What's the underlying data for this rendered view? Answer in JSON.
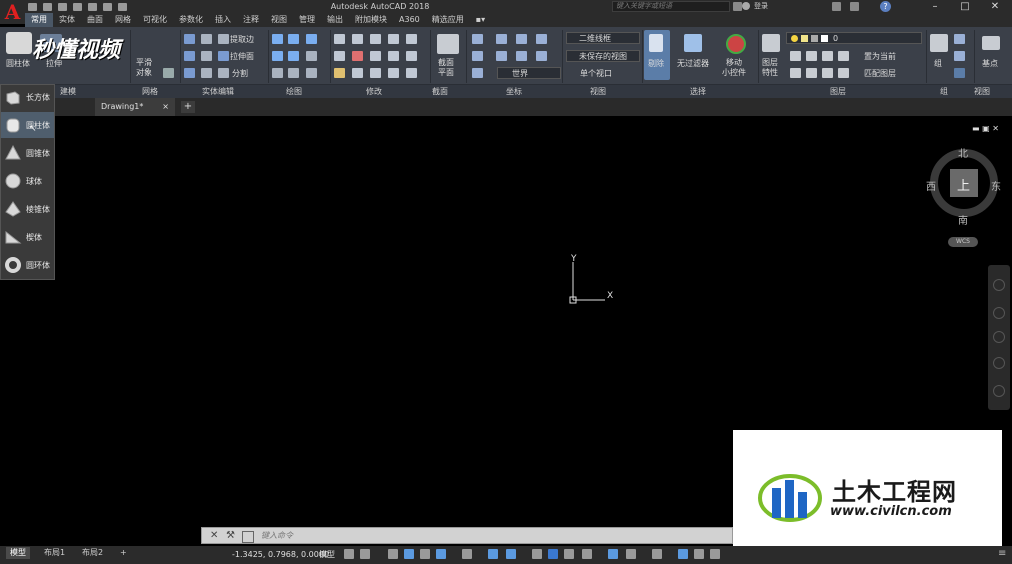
{
  "app": {
    "title": "Autodesk AutoCAD 2018"
  },
  "search": {
    "placeholder": "键入关键字或短语"
  },
  "user": {
    "login_label": "登录"
  },
  "ribbon_tabs": [
    "常用",
    "实体",
    "曲面",
    "网格",
    "可视化",
    "参数化",
    "插入",
    "注释",
    "视图",
    "管理",
    "输出",
    "附加模块",
    "A360",
    "精选应用"
  ],
  "ribbon": {
    "cylinder_btn": "圆柱体",
    "extrude_btn": "拉伸",
    "smooth_object": "平滑\n对象",
    "extract_edges": "提取边",
    "extrude_face": "拉伸面",
    "split": "分割",
    "section_plane": "截面\n平面",
    "visual_style": "二维线框",
    "saved_view": "未保存的视图",
    "ucs_world": "世界",
    "single_viewport": "单个视口",
    "culling": "剔除",
    "no_filter": "无过滤器",
    "move_gizmo": "移动\n小控件",
    "layer_props": "图层\n特性",
    "layer_name": "0",
    "set_current": "置为当前",
    "match_layer": "匹配图层",
    "group": "组",
    "base_point": "基点",
    "panel_labels": [
      "建模",
      "网格",
      "实体编辑",
      "绘图",
      "修改",
      "截面",
      "坐标",
      "视图",
      "选择",
      "图层",
      "组",
      "视图"
    ]
  },
  "doc_tab": {
    "name": "Drawing1*"
  },
  "solid_menu": {
    "items": [
      {
        "label": "长方体",
        "icon": "box-icon"
      },
      {
        "label": "圆柱体",
        "icon": "cylinder-icon",
        "selected": true
      },
      {
        "label": "圆锥体",
        "icon": "cone-icon"
      },
      {
        "label": "球体",
        "icon": "sphere-icon"
      },
      {
        "label": "棱锥体",
        "icon": "pyramid-icon"
      },
      {
        "label": "楔体",
        "icon": "wedge-icon"
      },
      {
        "label": "圆环体",
        "icon": "torus-icon"
      }
    ]
  },
  "viewcube": {
    "north": "北",
    "south": "南",
    "east": "东",
    "west": "西",
    "face": "上",
    "wcs": "WCS"
  },
  "ucs": {
    "x": "X",
    "y": "Y"
  },
  "watermark": {
    "brand": "秒懂视频",
    "site_cn": "土木工程网",
    "site_url": "www.civilcn.com"
  },
  "command": {
    "placeholder": "键入命令"
  },
  "layout_tabs": [
    "模型",
    "布局1",
    "布局2"
  ],
  "status": {
    "coords": "-1.3425, 0.7968, 0.0000",
    "mode": "模型"
  },
  "colors": {
    "accent": "#4f5e6d",
    "ribbon_bg": "#3b4049",
    "logo_red": "#e02020",
    "watermark_blue": "#1f66c4",
    "watermark_green": "#7cbd2a"
  }
}
